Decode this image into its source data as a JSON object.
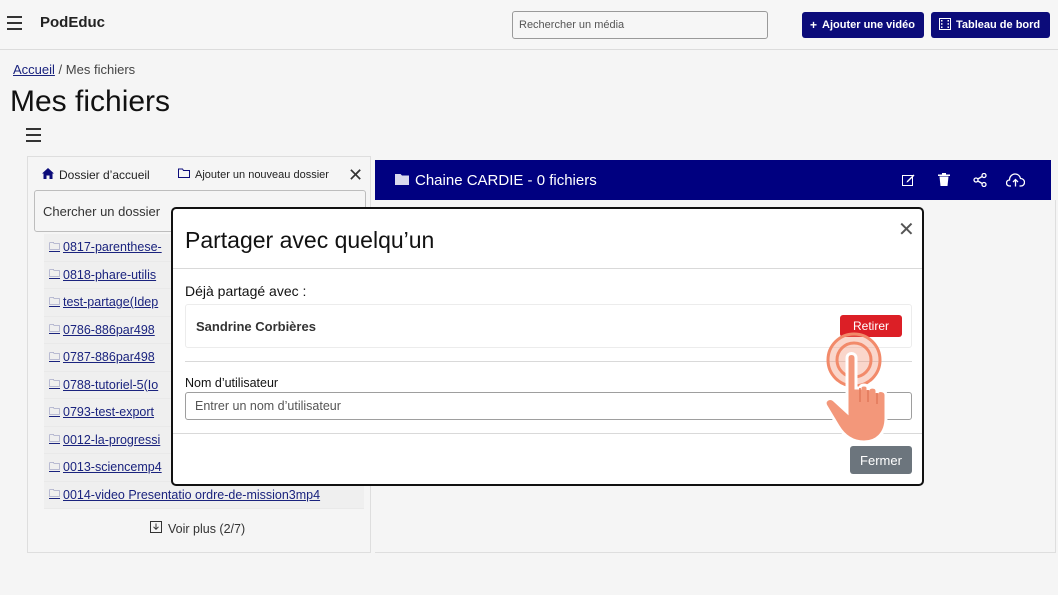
{
  "header": {
    "brand": "PodEduc",
    "search_placeholder": "Rechercher un média",
    "add_video_label": "Ajouter une vidéo",
    "dashboard_label": "Tableau de bord"
  },
  "breadcrumb": {
    "home": "Accueil",
    "separator": "/",
    "current": "Mes fichiers"
  },
  "page": {
    "title": "Mes fichiers"
  },
  "left_panel": {
    "home_label": "Dossier d’accueil",
    "new_folder_label": "Ajouter un nouveau dossier",
    "search_placeholder": "Chercher un dossier",
    "folders": [
      "0817-parenthese-",
      "0818-phare-utilis",
      "test-partage(Idep",
      "0786-886par498",
      "0787-886par498",
      "0788-tutoriel-5(Io",
      "0793-test-export",
      "0012-la-progressi",
      "0013-sciencemp4",
      "0014-video Presentatio   ordre-de-mission3mp4"
    ],
    "more_label": "Voir plus (2/7)"
  },
  "channel": {
    "title": "Chaine CARDIE - 0 fichiers"
  },
  "modal": {
    "title": "Partager avec quelqu’un",
    "shared_label": "Déjà partagé avec :",
    "shared_user": "Sandrine Corbières",
    "remove_label": "Retirer",
    "username_label": "Nom d’utilisateur",
    "username_placeholder": "Entrer un nom d’utilisateur",
    "close_label": "Fermer"
  },
  "colors": {
    "navy": "#000080",
    "danger": "#dc1f26",
    "secondary": "#6c757d",
    "link": "#1a237e"
  }
}
